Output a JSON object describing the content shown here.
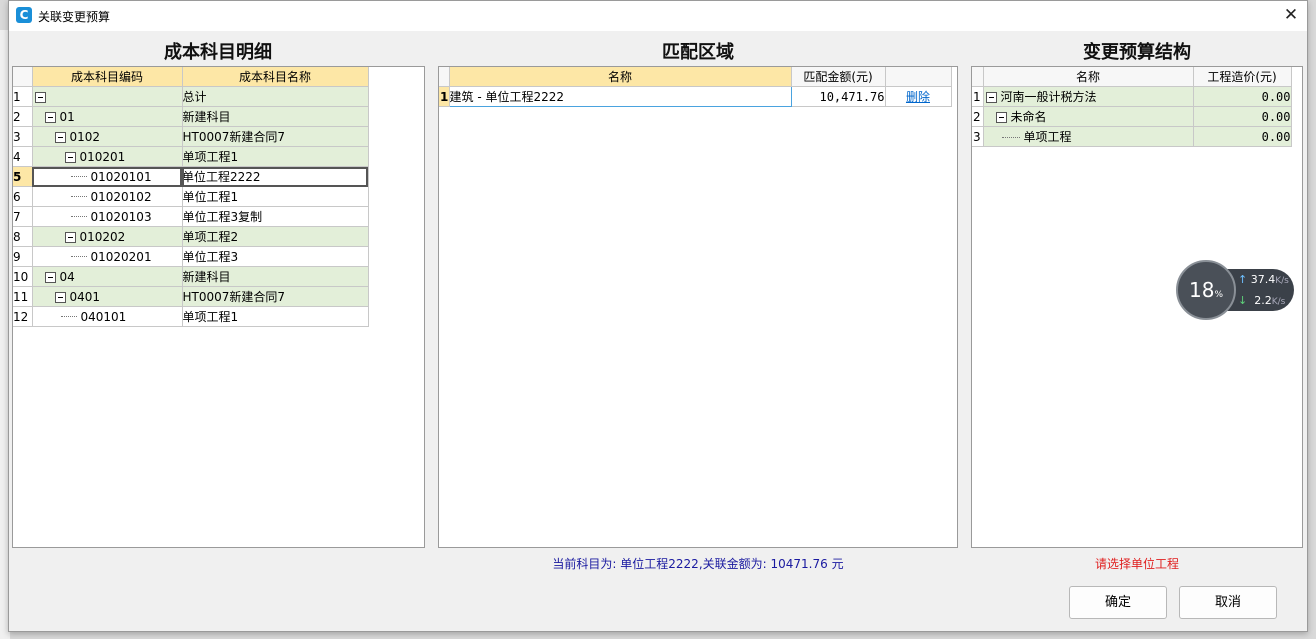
{
  "window": {
    "title": "关联变更预算",
    "close": "✕"
  },
  "left": {
    "title": "成本科目明细",
    "headers": [
      "成本科目编码",
      "成本科目名称"
    ],
    "rows": [
      {
        "n": "1",
        "code": "",
        "name": "总计"
      },
      {
        "n": "2",
        "code": "01",
        "name": "新建科目"
      },
      {
        "n": "3",
        "code": "0102",
        "name": "HT0007新建合同7"
      },
      {
        "n": "4",
        "code": "010201",
        "name": "单项工程1"
      },
      {
        "n": "5",
        "code": "01020101",
        "name": "单位工程2222"
      },
      {
        "n": "6",
        "code": "01020102",
        "name": "单位工程1"
      },
      {
        "n": "7",
        "code": "01020103",
        "name": "单位工程3复制"
      },
      {
        "n": "8",
        "code": "010202",
        "name": "单项工程2"
      },
      {
        "n": "9",
        "code": "01020201",
        "name": "单位工程3"
      },
      {
        "n": "10",
        "code": "04",
        "name": "新建科目"
      },
      {
        "n": "11",
        "code": "0401",
        "name": "HT0007新建合同7"
      },
      {
        "n": "12",
        "code": "040101",
        "name": "单项工程1"
      }
    ]
  },
  "middle": {
    "title": "匹配区域",
    "headers": [
      "名称",
      "匹配金额(元)"
    ],
    "rows": [
      {
        "n": "1",
        "name": "建筑 - 单位工程2222",
        "amount": "10,471.76",
        "action": "删除"
      }
    ],
    "status": "当前科目为: 单位工程2222,关联金额为: 10471.76 元"
  },
  "right": {
    "title": "变更预算结构",
    "headers": [
      "名称",
      "工程造价(元)"
    ],
    "rows": [
      {
        "n": "1",
        "name": "河南一般计税方法",
        "amount": "0.00"
      },
      {
        "n": "2",
        "name": "未命名",
        "amount": "0.00"
      },
      {
        "n": "3",
        "name": "单项工程",
        "amount": "0.00"
      }
    ],
    "status": "请选择单位工程"
  },
  "buttons": {
    "ok": "确定",
    "cancel": "取消"
  },
  "speed_widget": {
    "percent": "18",
    "percent_unit": "%",
    "up": "37.4",
    "down": "2.2",
    "unit": "K/s"
  },
  "colors": {
    "header_yellow": "#fde7a6",
    "row_green": "#e3efd9",
    "link": "#0066cc",
    "status_blue": "#1a1aa0",
    "status_red": "#e02020"
  }
}
